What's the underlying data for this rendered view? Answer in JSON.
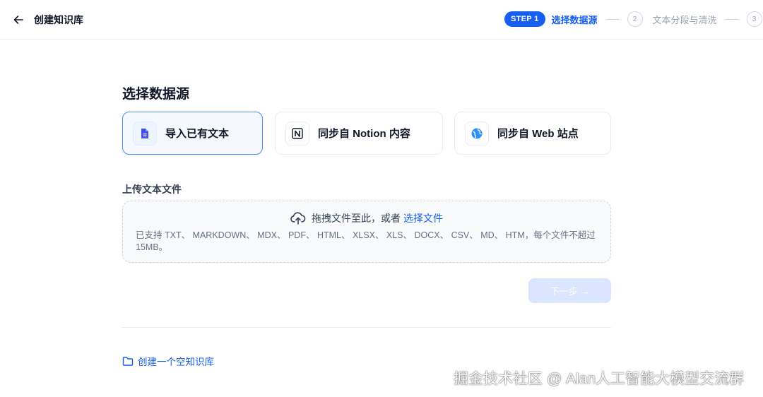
{
  "header": {
    "title": "创建知识库",
    "steps": [
      {
        "badge": "STEP 1",
        "label": "选择数据源"
      },
      {
        "badge": "2",
        "label": "文本分段与清洗"
      },
      {
        "badge": "3",
        "label": ""
      }
    ]
  },
  "main": {
    "section_title": "选择数据源",
    "sources": [
      {
        "label": "导入已有文本",
        "icon": "file-text-icon"
      },
      {
        "label": "同步自 Notion 内容",
        "icon": "notion-icon"
      },
      {
        "label": "同步自 Web 站点",
        "icon": "globe-icon"
      }
    ],
    "upload": {
      "title": "上传文本文件",
      "drag_text": "拖拽文件至此，或者",
      "select_link": "选择文件",
      "hint": "已支持 TXT、 MARKDOWN、 MDX、 PDF、 HTML、 XLSX、 XLS、 DOCX、 CSV、 MD、 HTM，每个文件不超过 15MB。"
    },
    "next_button": "下一步 →",
    "create_empty": "创建一个空知识库"
  },
  "watermark": "掘金技术社区 @ Alan人工智能大模型交流群",
  "colors": {
    "accent": "#155eef",
    "active_card_border": "#528bff",
    "disabled_button": "#dbe6fe"
  }
}
